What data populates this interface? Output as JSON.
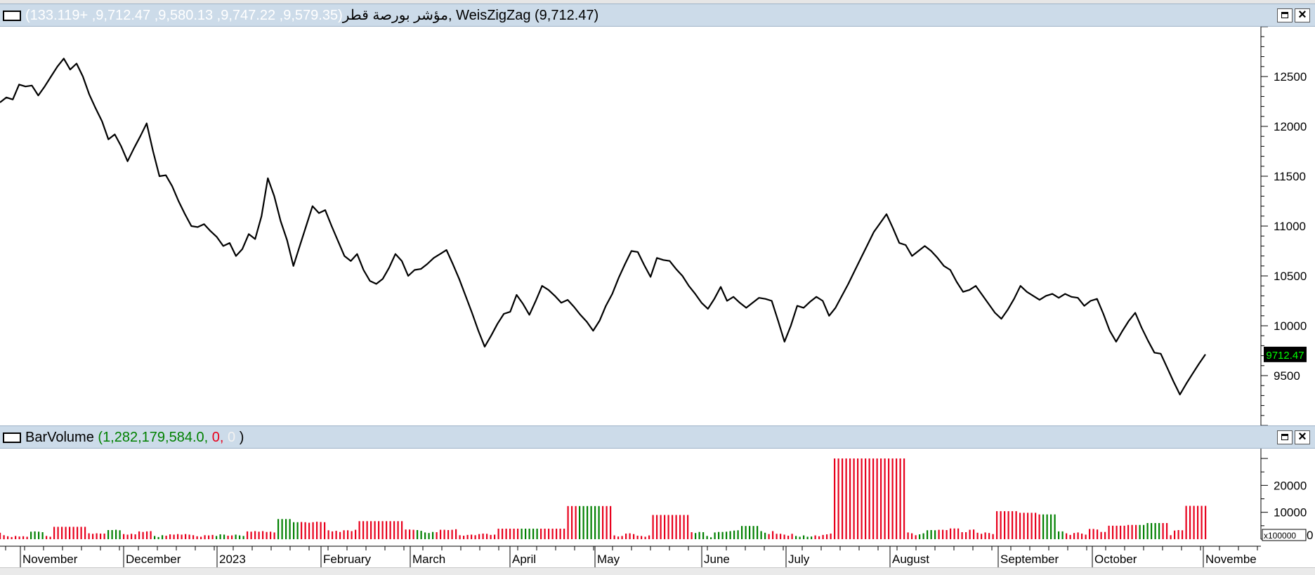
{
  "price_pane": {
    "symbol": "مؤشر بورصة قطر",
    "ohlc": "(9,579.35, 9,747.22, 9,580.13, 9,712.47, +133.119)",
    "separator": ", ",
    "indicator": "WeisZigZag (9,712.47)",
    "last_label": "9712.47",
    "colors": {
      "ohlc": "#ffffff",
      "line": "#000000",
      "last_bg": "#000000",
      "last_fg": "#00ff00"
    }
  },
  "volume_pane": {
    "title": "BarVolume",
    "open_paren": " (",
    "value_green": "1,282,179,584.0",
    "sep1": ", ",
    "value_red": "0",
    "sep2": ", ",
    "value_white": "0",
    "close_paren": " )",
    "multiplier": "x100000",
    "zero": "0",
    "colors": {
      "up": "#008000",
      "down": "#e8001c"
    }
  },
  "window_buttons": {
    "maximize_icon": "maximize-icon",
    "close_icon": "close-icon"
  },
  "time_axis": {
    "months": [
      "November",
      "December",
      "2023",
      "February",
      "March",
      "April",
      "May",
      "June",
      "July",
      "August",
      "September",
      "October",
      "Novembe"
    ]
  },
  "chart_data": [
    {
      "type": "line",
      "series": [
        {
          "values": [
            12240,
            12290,
            12270,
            12420,
            12400,
            12410,
            12310,
            12400,
            12500,
            12600,
            12680,
            12570,
            12630,
            12500,
            12320,
            12180,
            12050,
            11870,
            11920,
            11800,
            11650,
            11780,
            11900,
            12030,
            11750,
            11500,
            11510,
            11400,
            11250,
            11120,
            11000,
            10990,
            11020,
            10950,
            10890,
            10800,
            10830,
            10700,
            10770,
            10920,
            10870,
            11100,
            11480,
            11300,
            11050,
            10860,
            10600,
            10800,
            11000,
            11200,
            11130,
            11160,
            11000,
            10850,
            10700,
            10650,
            10720,
            10560,
            10450,
            10420,
            10470,
            10580,
            10720,
            10650,
            10500,
            10560,
            10570,
            10620,
            10680,
            10720,
            10760,
            10620,
            10470,
            10300,
            10130,
            9950,
            9790,
            9900,
            10020,
            10120,
            10140,
            10310,
            10220,
            10110,
            10250,
            10400,
            10360,
            10300,
            10230,
            10260,
            10190,
            10110,
            10040,
            9950,
            10050,
            10200,
            10320,
            10480,
            10620,
            10750,
            10740,
            10610,
            10490,
            10680,
            10660,
            10650,
            10570,
            10500,
            10400,
            10320,
            10230,
            10170,
            10270,
            10390,
            10250,
            10290,
            10230,
            10180,
            10230,
            10280,
            10270,
            10250,
            10050,
            9840,
            10000,
            10200,
            10180,
            10240,
            10290,
            10250,
            10100,
            10180,
            10300,
            10420,
            10550,
            10680,
            10810,
            10940,
            11030,
            11120,
            10980,
            10830,
            10810,
            10700,
            10750,
            10800,
            10750,
            10680,
            10600,
            10560,
            10440,
            10340,
            10360,
            10400,
            10310,
            10220,
            10130,
            10070,
            10160,
            10270,
            10400,
            10340,
            10300,
            10260,
            10300,
            10320,
            10280,
            10320,
            10290,
            10280,
            10200,
            10250,
            10270,
            10120,
            9950,
            9840,
            9950,
            10050,
            10130,
            9980,
            9850,
            9730,
            9720,
            9580,
            9440,
            9310,
            9420,
            9520,
            9620,
            9712.47
          ]
        }
      ],
      "ylim": [
        9000,
        13000
      ],
      "yticks": [
        9500,
        10000,
        10500,
        11000,
        11500,
        12000,
        12500
      ],
      "last_value": 9712.47,
      "grid": false
    },
    {
      "type": "bar",
      "series": [
        {
          "name": "up",
          "values": [
            0,
            0,
            0,
            0,
            0,
            0,
            0,
            0,
            1,
            1,
            1,
            1,
            0,
            0,
            0,
            0,
            0,
            0,
            0,
            0,
            0,
            0,
            0,
            0,
            0,
            0,
            0,
            0,
            1,
            1,
            1,
            1,
            0,
            0,
            0,
            0,
            0,
            0,
            0,
            0,
            1,
            1,
            1,
            0,
            0,
            0,
            0,
            0,
            0,
            0,
            0,
            0,
            0,
            0,
            0,
            0,
            1,
            1,
            1,
            0,
            0,
            1,
            1,
            1,
            0,
            0,
            0,
            0,
            0,
            0,
            0,
            0,
            1,
            1,
            1,
            1,
            1,
            1,
            0,
            0,
            0,
            0,
            0,
            0,
            0,
            0,
            0,
            0,
            0,
            0,
            0,
            0,
            0,
            0,
            0,
            0,
            0,
            0,
            0,
            0,
            0,
            0,
            0,
            0,
            0,
            0,
            0,
            0,
            1,
            1,
            1,
            1,
            1,
            0,
            0,
            0,
            0,
            0,
            0,
            0,
            0,
            0,
            0,
            0,
            0,
            0,
            0,
            0,
            0,
            0,
            0,
            0,
            0,
            0,
            0,
            1,
            1,
            1,
            1,
            1,
            0,
            0,
            0,
            0,
            0,
            0,
            0,
            0,
            0,
            0,
            1,
            1,
            1,
            1,
            1,
            1,
            0,
            0,
            0,
            0,
            0,
            0,
            0,
            0,
            0,
            0,
            0,
            0,
            0,
            0,
            0,
            0,
            0,
            0,
            0,
            0,
            0,
            0,
            0,
            0,
            1,
            1,
            1,
            1,
            1,
            1,
            1,
            1,
            1,
            1,
            1,
            1,
            1,
            1,
            1,
            1,
            1,
            1,
            1,
            0,
            0,
            0,
            0,
            0,
            0,
            0,
            1,
            1,
            1,
            1,
            1,
            0,
            0,
            0,
            0,
            0,
            0,
            0,
            0,
            0,
            0,
            0,
            0,
            0,
            0,
            0,
            0,
            0,
            0,
            0,
            0,
            0,
            0,
            0,
            0,
            0,
            0,
            0,
            1,
            1,
            1,
            1,
            1,
            0,
            0,
            0,
            0,
            0,
            0,
            0,
            0,
            0,
            0,
            0,
            0,
            0,
            0,
            0,
            0,
            0,
            0,
            0,
            0,
            0,
            0,
            0,
            0,
            0,
            0,
            0,
            1,
            1,
            1,
            1,
            1,
            1,
            0,
            0,
            0,
            0,
            0,
            0,
            0,
            0,
            0,
            0,
            0,
            0,
            0,
            0,
            0,
            0,
            0,
            0,
            0,
            1,
            1,
            1,
            1,
            1,
            1
          ]
        }
      ],
      "volumes_x100000": [
        2400,
        1500,
        1100,
        800,
        1200,
        1000,
        1100,
        900,
        2800,
        2900,
        2800,
        2600,
        1200,
        900,
        4600,
        4600,
        4600,
        4600,
        4600,
        4600,
        4600,
        4600,
        4600,
        2200,
        2000,
        2200,
        2100,
        2100,
        3400,
        3400,
        3500,
        3300,
        1900,
        1700,
        2000,
        1800,
        2900,
        2700,
        2900,
        3000,
        1200,
        800,
        1500,
        1300,
        1800,
        1700,
        1900,
        1700,
        1900,
        1700,
        1500,
        1100,
        900,
        1500,
        1400,
        1600,
        1200,
        1800,
        1700,
        1300,
        1400,
        1700,
        1400,
        1200,
        2900,
        2800,
        3000,
        2800,
        3000,
        2700,
        2800,
        2500,
        7500,
        7500,
        7500,
        7500,
        6300,
        6300,
        6400,
        6300,
        6100,
        6300,
        6500,
        6400,
        6300,
        3300,
        2900,
        3100,
        2700,
        3300,
        3300,
        3000,
        3500,
        6700,
        6700,
        6700,
        6700,
        6700,
        6700,
        6700,
        6700,
        6700,
        6700,
        6700,
        6700,
        3600,
        3600,
        3500,
        3400,
        3100,
        2500,
        2300,
        2700,
        2600,
        3500,
        3500,
        3400,
        3500,
        3700,
        1500,
        1300,
        1600,
        1700,
        1500,
        1900,
        2100,
        2000,
        1600,
        1700,
        3900,
        3900,
        3900,
        3900,
        3900,
        3900,
        3900,
        3900,
        3900,
        3900,
        3900,
        3900,
        3900,
        3900,
        3900,
        3900,
        3900,
        3900,
        12300,
        12300,
        12300,
        12300,
        12300,
        12300,
        12300,
        12300,
        12300,
        12300,
        12300,
        12300,
        1400,
        1000,
        1200,
        2100,
        2200,
        1900,
        1300,
        1200,
        900,
        1400,
        9000,
        9000,
        9000,
        9000,
        9000,
        9000,
        9000,
        9000,
        9000,
        9000,
        2600,
        2300,
        2700,
        2600,
        1200,
        700,
        2500,
        2700,
        2700,
        2800,
        3000,
        3200,
        3300,
        4900,
        4900,
        4900,
        4900,
        4900,
        3000,
        2400,
        1900,
        3000,
        2000,
        2000,
        1700,
        1300,
        2000,
        1200,
        900,
        1400,
        900,
        1000,
        1400,
        1100,
        1600,
        1800,
        2100,
        30000,
        30000,
        30000,
        30000,
        30000,
        30000,
        30000,
        30000,
        30000,
        30000,
        30000,
        30000,
        30000,
        30000,
        30000,
        30000,
        30000,
        30000,
        30000,
        2500,
        2200,
        1500,
        1800,
        2200,
        3300,
        3400,
        3300,
        3500,
        3500,
        3400,
        4000,
        4000,
        4000,
        2600,
        2600,
        3500,
        3600,
        2400,
        2000,
        2500,
        2300,
        1900,
        10400,
        10400,
        10400,
        10400,
        10400,
        10400,
        9800,
        9800,
        9800,
        9800,
        9800,
        9200,
        9200,
        9200,
        9200,
        9200,
        2900,
        2900,
        2200,
        1600,
        2300,
        2500,
        2100,
        1700,
        3800,
        3800,
        3600,
        2700,
        2700,
        5000,
        5000,
        5000,
        5000,
        5000,
        5300,
        5300,
        5300,
        5300,
        5300,
        6000,
        6000,
        6000,
        6000,
        6000,
        6000,
        1500,
        3200,
        3400,
        3300,
        12400,
        12400,
        12400,
        12400,
        12400,
        12400
      ],
      "ylim": [
        0,
        30000
      ],
      "yticks": [
        10000,
        20000
      ]
    }
  ]
}
